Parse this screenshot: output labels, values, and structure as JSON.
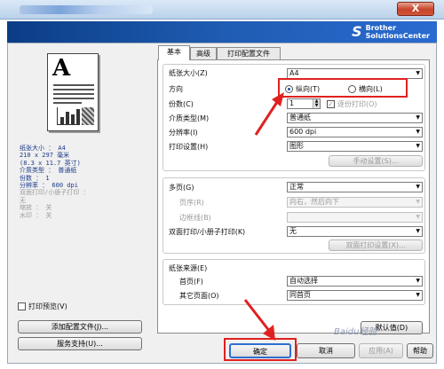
{
  "window": {
    "brand_line1": "Brother",
    "brand_line2": "SolutionsCenter",
    "close_label": "X"
  },
  "tabs": [
    {
      "label": "基本"
    },
    {
      "label": "高级"
    },
    {
      "label": "打印配置文件"
    }
  ],
  "summary": {
    "paper_size": "纸张大小 ： A4",
    "dims_mm": "210 x 297 毫米",
    "dims_in": "(8.3 x 11.7 英寸)",
    "media_type": "介质类型 ： 普通纸",
    "copies": "份数 ： 1",
    "resolution": "分辨率 ： 600 dpi",
    "duplex": "双面打印/小册子打印 ：",
    "duplex_value": "无",
    "scaling": "缩放 ： 关",
    "watermark": "水印 ： 关"
  },
  "left": {
    "print_preview": "打印预览(V)",
    "add_profile": "添加配置文件(J)...",
    "support": "服务支持(U)..."
  },
  "form": {
    "paper_size_label": "纸张大小(Z)",
    "paper_size_value": "A4",
    "orientation_label": "方向",
    "portrait": "纵向(T)",
    "landscape": "横向(L)",
    "copies_label": "份数(C)",
    "copies_value": "1",
    "collate": "逐份打印(O)",
    "media_label": "介质类型(M)",
    "media_value": "普通纸",
    "resolution_label": "分辨率(I)",
    "resolution_value": "600 dpi",
    "print_settings_label": "打印设置(H)",
    "print_settings_value": "图形",
    "manual_settings": "手动设置(S)...",
    "multipage_label": "多页(G)",
    "multipage_value": "正常",
    "page_order_label": "页序(R)",
    "page_order_value": "向右，然后向下",
    "border_label": "边框线(B)",
    "border_value": "",
    "duplex_label": "双面打印/小册子打印(K)",
    "duplex_value": "无",
    "duplex_settings": "双面打印设置(X)...",
    "source_label": "纸张来源(E)",
    "first_page_label": "首页(F)",
    "first_page_value": "自动选择",
    "other_pages_label": "其它页面(O)",
    "other_pages_value": "同首页",
    "defaults": "默认值(D)"
  },
  "bottom": {
    "ok": "确定",
    "cancel": "取消",
    "apply": "应用(A)",
    "help": "帮助"
  },
  "watermark_text": "Baidu经验",
  "colors": {
    "annotation_red": "#e02020",
    "banner_blue": "#1f5cb2"
  }
}
